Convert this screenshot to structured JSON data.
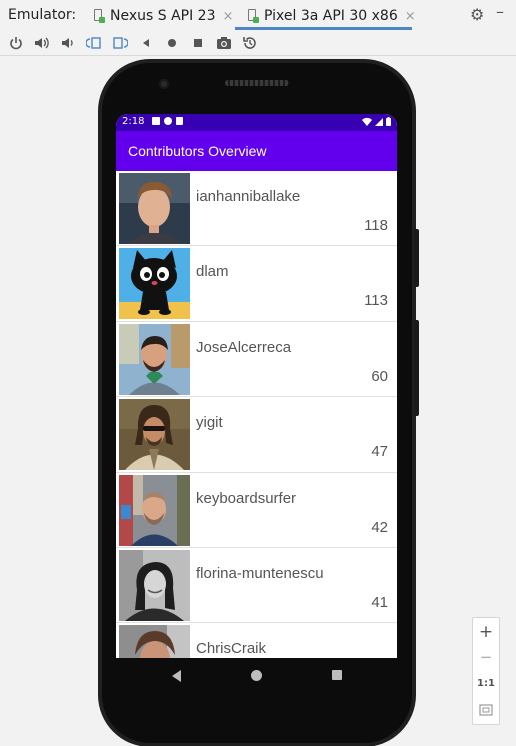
{
  "emulator": {
    "label": "Emulator:",
    "tabs": [
      {
        "label": "Nexus S API 23",
        "close": "×"
      },
      {
        "label": "Pixel 3a API 30 x86",
        "close": "×"
      }
    ]
  },
  "toolbar": {
    "icons": [
      "power-icon",
      "volume-up-icon",
      "volume-down-icon",
      "rotate-left-icon",
      "rotate-right-icon",
      "back-icon",
      "home-icon",
      "overview-icon",
      "screenshot-icon",
      "snapshot-icon"
    ]
  },
  "device": {
    "status_time": "2:18",
    "app_title": "Contributors Overview",
    "contributors": [
      {
        "name": "ianhanniballake",
        "count": "118"
      },
      {
        "name": "dlam",
        "count": "113"
      },
      {
        "name": "JoseAlcerreca",
        "count": "60"
      },
      {
        "name": "yigit",
        "count": "47"
      },
      {
        "name": "keyboardsurfer",
        "count": "42"
      },
      {
        "name": "florina-muntenescu",
        "count": "41"
      },
      {
        "name": "ChrisCraik",
        "count": ""
      }
    ]
  },
  "zoom_panel": {
    "zoom_in": "+",
    "zoom_out": "−",
    "actual_size": "1:1"
  },
  "colors": {
    "status_bar": "#3700b3",
    "app_bar": "#6200ee",
    "active_tab_underline": "#4a86c8"
  }
}
